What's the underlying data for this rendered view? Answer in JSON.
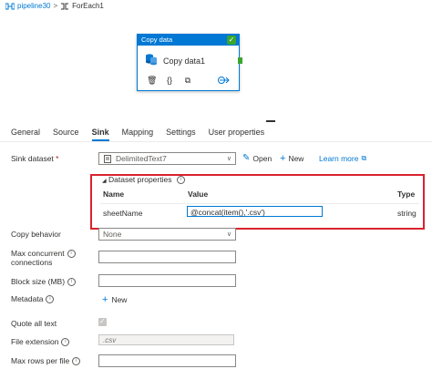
{
  "breadcrumb": {
    "pipeline": "pipeline30",
    "separator": ">",
    "current": "ForEach1"
  },
  "activity": {
    "header": "Copy data",
    "name": "Copy data1",
    "status_icon": "check-icon"
  },
  "tabs": [
    "General",
    "Source",
    "Sink",
    "Mapping",
    "Settings",
    "User properties"
  ],
  "active_tab": "Sink",
  "sink": {
    "dataset_label": "Sink dataset",
    "required_mark": "*",
    "dataset_value": "DelimitedText7",
    "open_label": "Open",
    "new_label": "New",
    "learn_more": "Learn more"
  },
  "dataset_properties": {
    "title": "Dataset properties",
    "columns": {
      "name": "Name",
      "value": "Value",
      "type": "Type"
    },
    "row": {
      "name": "sheetName",
      "value": "@concat(item(),'.csv')",
      "type": "string"
    }
  },
  "form": {
    "copy_behavior": {
      "label": "Copy behavior",
      "value": "None"
    },
    "max_concurrent": {
      "label_line1": "Max concurrent",
      "label_line2": "connections"
    },
    "block_size": {
      "label": "Block size (MB)"
    },
    "metadata": {
      "label": "Metadata",
      "new_label": "New"
    },
    "quote_all_text": {
      "label": "Quote all text",
      "checked": true
    },
    "file_extension": {
      "label": "File extension",
      "placeholder": ".csv"
    },
    "max_rows": {
      "label": "Max rows per file"
    }
  },
  "colors": {
    "accent": "#0078d4",
    "success": "#3aa52f",
    "highlight": "#d9232e"
  }
}
